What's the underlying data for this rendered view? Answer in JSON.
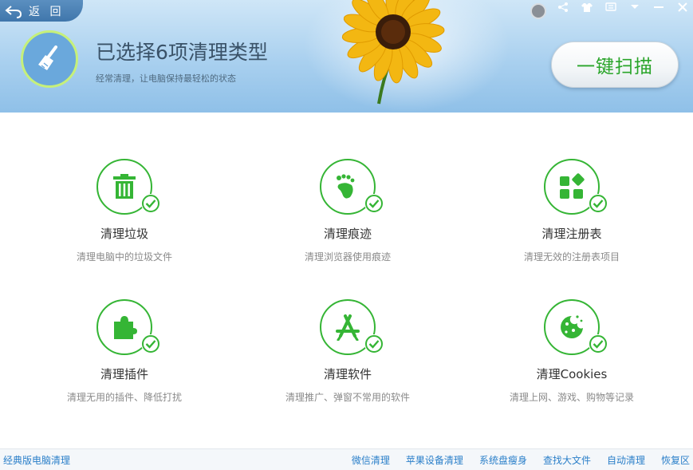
{
  "header": {
    "back_label": "返 回",
    "title": "已选择6项清理类型",
    "subtitle": "经常清理，让电脑保持最轻松的状态",
    "scan_button": "一键扫描"
  },
  "window_controls": [
    "skin-icon",
    "share-icon",
    "shirt-icon",
    "menu-icon",
    "dropdown-icon",
    "minimize-icon",
    "close-icon"
  ],
  "categories": [
    {
      "title": "清理垃圾",
      "desc": "清理电脑中的垃圾文件",
      "icon": "trash-icon",
      "checked": true
    },
    {
      "title": "清理痕迹",
      "desc": "清理浏览器使用痕迹",
      "icon": "footprint-icon",
      "checked": true
    },
    {
      "title": "清理注册表",
      "desc": "清理无效的注册表项目",
      "icon": "registry-blocks-icon",
      "checked": true
    },
    {
      "title": "清理插件",
      "desc": "清理无用的插件、降低打扰",
      "icon": "puzzle-icon",
      "checked": true
    },
    {
      "title": "清理软件",
      "desc": "清理推广、弹窗不常用的软件",
      "icon": "app-store-icon",
      "checked": true
    },
    {
      "title": "清理Cookies",
      "desc": "清理上网、游戏、购物等记录",
      "icon": "cookie-icon",
      "checked": true
    }
  ],
  "footer": {
    "classic": "经典版电脑清理",
    "links": [
      "微信清理",
      "苹果设备清理",
      "系统盘瘦身",
      "查找大文件",
      "自动清理",
      "恢复区"
    ]
  },
  "colors": {
    "accent_green": "#35b535",
    "link_blue": "#2a7fc9",
    "header_blue": "#a9d0ef"
  }
}
